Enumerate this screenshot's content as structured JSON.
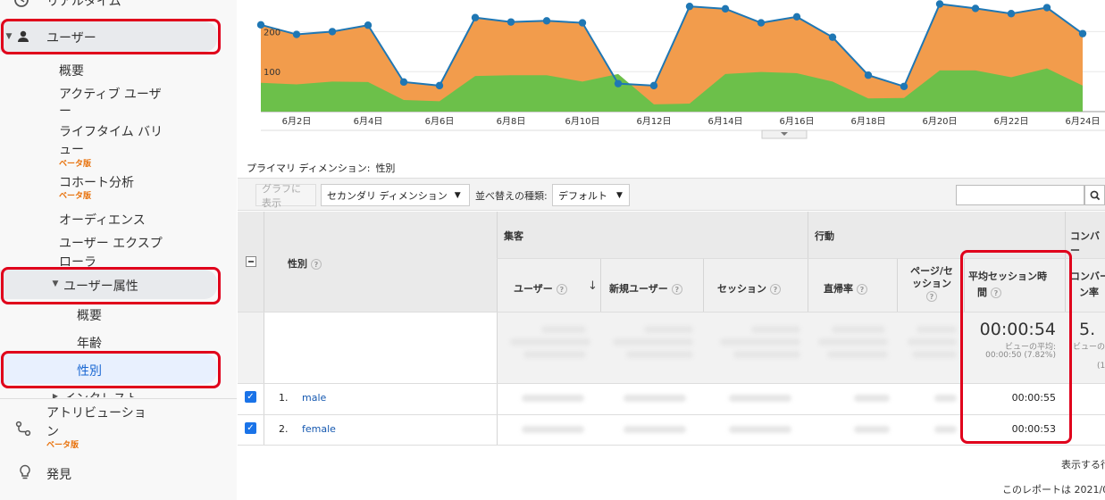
{
  "sidebar": {
    "realtime_label": "リアルタイム",
    "users_label": "ユーザー",
    "sub_items": {
      "overview": "概要",
      "active_users_1": "アクティブ ユーザ",
      "active_users_2": "ー",
      "lifetime_value_1": "ライフタイム バリ",
      "lifetime_value_2": "ュー",
      "lifetime_badge": "ベータ版",
      "cohort": "コホート分析",
      "cohort_badge": "ベータ版",
      "audience": "オーディエンス",
      "explorer_1": "ユーザー エクスプ",
      "explorer_2": "ローラ",
      "demographics": "ユーザー属性",
      "demo_overview": "概要",
      "demo_age": "年齢",
      "demo_gender": "性別",
      "interests": "インタレスト"
    },
    "attribution_1": "アトリビューショ",
    "attribution_2": "ン",
    "attribution_badge": "ベータ版",
    "discover_label": "発見"
  },
  "chart_data": {
    "type": "area",
    "x_labels": [
      "6月2日",
      "6月4日",
      "6月6日",
      "6月8日",
      "6月10日",
      "6月12日",
      "6月14日",
      "6月16日",
      "6月18日",
      "6月20日",
      "6月22日",
      "6月24日"
    ],
    "y_ticks": [
      "200",
      "100"
    ],
    "series": [
      {
        "values": [
          217,
          193,
          200,
          216,
          74,
          65,
          235,
          224,
          227,
          222,
          70,
          65,
          263,
          257,
          222,
          237,
          186,
          91,
          63,
          269,
          258,
          245,
          260,
          195
        ]
      },
      {
        "values": [
          72,
          68,
          75,
          74,
          29,
          26,
          89,
          91,
          91,
          75,
          94,
          18,
          20,
          94,
          99,
          96,
          75,
          33,
          34,
          103,
          103,
          86,
          108,
          65
        ]
      }
    ],
    "colors": {
      "total_fill": "#f29c4c",
      "total_line": "#1f77b4",
      "green_fill": "#6cc04a",
      "point": "#1f77b4"
    }
  },
  "primary_dimension": {
    "label": "プライマリ ディメンション:",
    "value": "性別"
  },
  "toolbar": {
    "graph_button": "グラフに表示",
    "secondary_dimension": "セカンダリ ディメンション",
    "sort_label": "並べ替えの種類:",
    "sort_value": "デフォルト",
    "search_placeholder": ""
  },
  "table": {
    "dimension_header": "性別",
    "group_acquisition": "集客",
    "group_behavior": "行動",
    "group_conversion": "コンバー",
    "columns": {
      "users": "ユーザー",
      "new_users": "新規ユーザー",
      "sessions": "セッション",
      "bounce_rate": "直帰率",
      "pages_per_session_1": "ページ/セ",
      "pages_per_session_2": "ッション",
      "avg_session_duration_1": "平均セッション時",
      "avg_session_duration_2": "間",
      "conversion_1": "コンバー",
      "conversion_2": "ン率"
    },
    "help_icon": "?",
    "totals": {
      "avg_session_duration": "00:00:54",
      "avg_caption": "ビューの平均:",
      "avg_detail": "00:00:50 (7.82%)",
      "conversion_partial": "5.",
      "conversion_caption_partial": "ビューの",
      "conversion_detail_partial": "(1"
    },
    "rows": [
      {
        "index": "1.",
        "gender": "male",
        "avg_session_duration": "00:00:55"
      },
      {
        "index": "2.",
        "gender": "female",
        "avg_session_duration": "00:00:53"
      }
    ]
  },
  "footer": {
    "rows_label": "表示する行",
    "report_note": "このレポートは 2021/0"
  }
}
